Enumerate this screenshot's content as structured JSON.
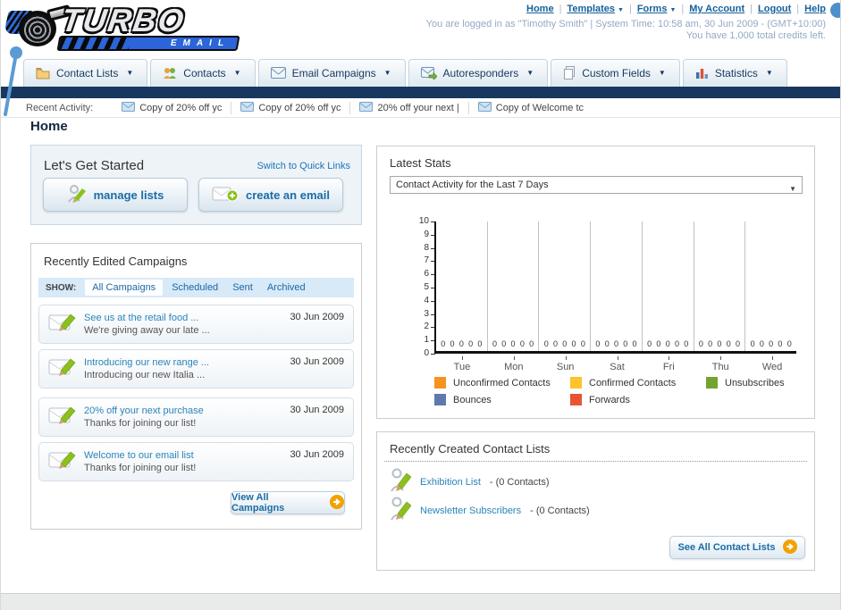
{
  "header": {
    "logo_line1": "TURBO",
    "logo_line2": "EMAIL",
    "nav_links": [
      {
        "label": "Home",
        "dropdown": false
      },
      {
        "label": "Templates",
        "dropdown": true
      },
      {
        "label": "Forms",
        "dropdown": true
      },
      {
        "label": "My Account",
        "dropdown": false
      },
      {
        "label": "Logout",
        "dropdown": false
      },
      {
        "label": "Help",
        "dropdown": false
      }
    ],
    "login_info": "You are logged in as \"Timothy Smith\" | System Time: 10:58 am, 30 Jun 2009 - (GMT+10:00)",
    "credits_info": "You have 1,000 total credits left."
  },
  "main_nav": [
    {
      "label": "Contact Lists",
      "icon": "folder-icon"
    },
    {
      "label": "Contacts",
      "icon": "contacts-icon"
    },
    {
      "label": "Email Campaigns",
      "icon": "envelope-icon"
    },
    {
      "label": "Autoresponders",
      "icon": "envelope-arrow-icon"
    },
    {
      "label": "Custom Fields",
      "icon": "pages-icon"
    },
    {
      "label": "Statistics",
      "icon": "bar-chart-icon"
    }
  ],
  "recent_activity": {
    "label": "Recent Activity:",
    "items": [
      "Copy of 20% off yc",
      "Copy of 20% off yc",
      "20% off your next |",
      "Copy of Welcome tc"
    ]
  },
  "page_title": "Home",
  "get_started": {
    "title": "Let's Get Started",
    "switch_link": "Switch to Quick Links",
    "manage_lists_label": "manage lists",
    "create_email_label": "create an email"
  },
  "campaigns": {
    "title": "Recently Edited Campaigns",
    "show_label": "SHOW:",
    "filters": [
      "All Campaigns",
      "Scheduled",
      "Sent",
      "Archived"
    ],
    "active_filter": "All Campaigns",
    "items": [
      {
        "title": "See us at the retail food ...",
        "subtitle": "We're giving away our late ...",
        "date": "30 Jun 2009"
      },
      {
        "title": "Introducing our new range ...",
        "subtitle": "Introducing our new Italia ...",
        "date": "30 Jun 2009"
      },
      {
        "title": "20% off your next purchase",
        "subtitle": "Thanks for joining our list!",
        "date": "30 Jun 2009"
      },
      {
        "title": "Welcome to our email list",
        "subtitle": "Thanks for joining our list!",
        "date": "30 Jun 2009"
      }
    ],
    "view_all_label": "View All Campaigns"
  },
  "stats": {
    "title": "Latest Stats",
    "dropdown_value": "Contact Activity for the Last 7 Days"
  },
  "chart_data": {
    "type": "bar",
    "title": "Contact Activity for the Last 7 Days",
    "categories": [
      "Tue",
      "Mon",
      "Sun",
      "Sat",
      "Fri",
      "Thu",
      "Wed"
    ],
    "series": [
      {
        "name": "Unconfirmed Contacts",
        "color": "#f6921e",
        "values": [
          0,
          0,
          0,
          0,
          0,
          0,
          0
        ]
      },
      {
        "name": "Confirmed Contacts",
        "color": "#fdc32d",
        "values": [
          0,
          0,
          0,
          0,
          0,
          0,
          0
        ]
      },
      {
        "name": "Unsubscribes",
        "color": "#71a32d",
        "values": [
          0,
          0,
          0,
          0,
          0,
          0,
          0
        ]
      },
      {
        "name": "Bounces",
        "color": "#5e79ab",
        "values": [
          0,
          0,
          0,
          0,
          0,
          0,
          0
        ]
      },
      {
        "name": "Forwards",
        "color": "#e85334",
        "values": [
          0,
          0,
          0,
          0,
          0,
          0,
          0
        ]
      }
    ],
    "ylim": [
      0,
      10
    ],
    "yticks": [
      0,
      1,
      2,
      3,
      4,
      5,
      6,
      7,
      8,
      9,
      10
    ],
    "grid": "vertical-only",
    "legend_position": "bottom",
    "data_labels": "zeros shown above baseline for every series in every category"
  },
  "contact_lists": {
    "title": "Recently Created Contact Lists",
    "items": [
      {
        "name": "Exhibition List",
        "detail": "- (0 Contacts)"
      },
      {
        "name": "Newsletter Subscribers",
        "detail": "- (0 Contacts)"
      }
    ],
    "see_all_label": "See All Contact Lists"
  }
}
